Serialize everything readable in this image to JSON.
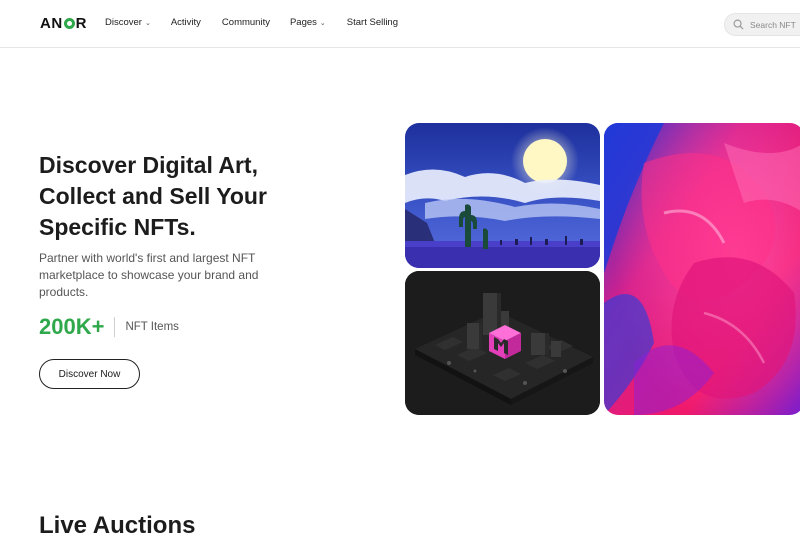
{
  "header": {
    "logo": "ANOR",
    "nav": {
      "discover": "Discover",
      "activity": "Activity",
      "community": "Community",
      "pages": "Pages",
      "start_selling": "Start Selling"
    },
    "search": {
      "placeholder": "Search NFT"
    }
  },
  "hero": {
    "title_line1": "Discover Digital Art,",
    "title_line2": "Collect and Sell Your",
    "title_line3": "Specific NFTs.",
    "subtitle": "Partner with world's first and largest NFT marketplace to showcase your brand and products.",
    "stat_value": "200K+",
    "stat_label": "NFT Items",
    "cta_label": "Discover Now"
  },
  "sections": {
    "live_auctions": "Live Auctions"
  },
  "colors": {
    "accent": "#2ea84a",
    "text": "#1c1c1c"
  },
  "icons": [
    "search-icon",
    "chevron-down-icon"
  ]
}
